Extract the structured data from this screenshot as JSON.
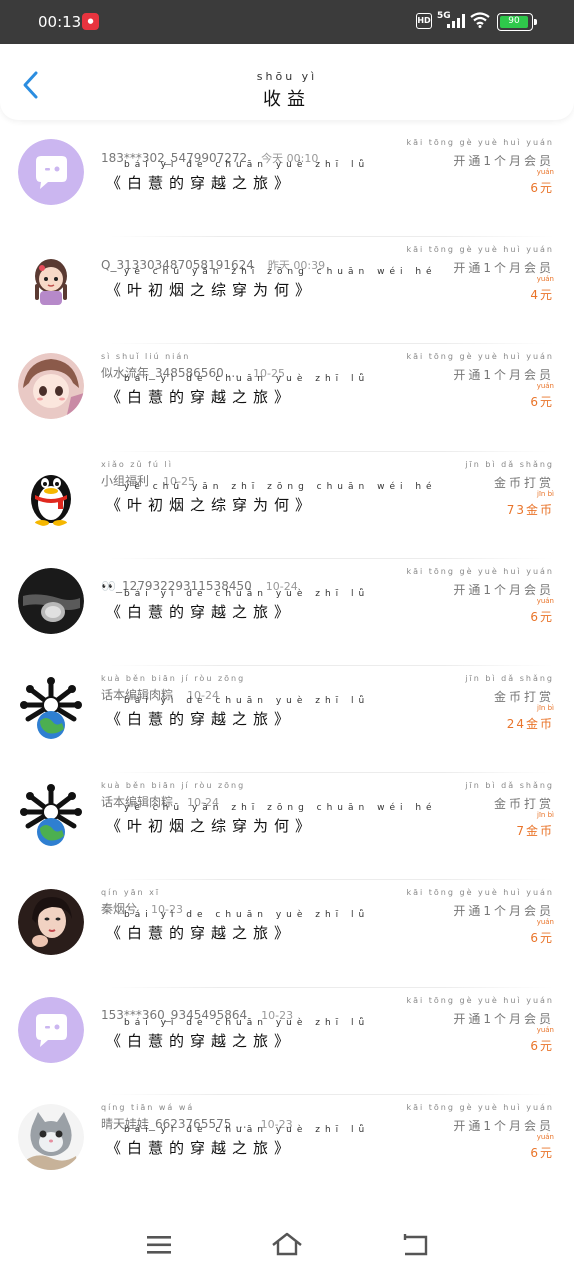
{
  "status_bar": {
    "time": "00:13",
    "app_badge": "doubao",
    "hd": "HD",
    "network": "5G",
    "battery": "90",
    "battery_color": "#2fc84b"
  },
  "header": {
    "back_icon": "chevron-left-icon",
    "title_pinyin": "shōu yì",
    "title": "收益",
    "accent_color": "#2b8de0"
  },
  "items": [
    {
      "avatar": "chat-bubble-avatar",
      "name_pinyin": "",
      "name": "183***302_5479907272",
      "time_pinyin": "jīn tiān",
      "time": "今天 00:10",
      "book_pinyin": "bái yì de chuān yuè zhī lǚ",
      "book": "《白薏的穿越之旅》",
      "type_pinyin": "kāi tōng gè yuè huì yuán",
      "type": "开通1个月会员",
      "amount_pinyin": "yuán",
      "amount": "6元"
    },
    {
      "avatar": "girl-doll-avatar",
      "name_pinyin": "",
      "name": "Q_3133034870581916​24",
      "time_pinyin": "zuó tiān",
      "time": "昨天 00:39",
      "book_pinyin": "yè chū yān zhī zōng chuān wéi hé",
      "book": "《叶初烟之综穿为何》",
      "type_pinyin": "kāi tōng gè yuè huì yuán",
      "type": "开通1个月会员",
      "amount_pinyin": "yuán",
      "amount": "4元"
    },
    {
      "avatar": "anime-girl-avatar",
      "name_pinyin": "sì shuǐ liú nián",
      "name": "似水流年_348586560 ...",
      "time_pinyin": "",
      "time": "10-25",
      "book_pinyin": "bái yì de chuān yuè zhī lǚ",
      "book": "《白薏的穿越之旅》",
      "type_pinyin": "kāi tōng gè yuè huì yuán",
      "type": "开通1个月会员",
      "amount_pinyin": "yuán",
      "amount": "6元"
    },
    {
      "avatar": "penguin-avatar",
      "name_pinyin": "xiǎo zǔ fú lì",
      "name": "小组福利",
      "time_pinyin": "",
      "time": "10-25",
      "book_pinyin": "yè chū yān zhī zōng chuān wéi hé",
      "book": "《叶初烟之综穿为何》",
      "type_pinyin": "jīn bì dǎ shǎng",
      "type": "金币打赏",
      "amount_pinyin": "jīn bì",
      "amount": "73金币"
    },
    {
      "avatar": "dark-photo-avatar",
      "name_pinyin": "",
      "name": "👀_1279322931​1538450",
      "time_pinyin": "",
      "time": "10-24",
      "book_pinyin": "bái yì de chuān yuè zhī lǚ",
      "book": "《白薏的穿越之旅》",
      "type_pinyin": "kāi tōng gè yuè huì yuán",
      "type": "开通1个月会员",
      "amount_pinyin": "yuán",
      "amount": "6元"
    },
    {
      "avatar": "bone-globe-avatar",
      "name_pinyin": "kuà běn biān jí ròu zōng",
      "name": "话本编辑肉粽",
      "time_pinyin": "",
      "time": "10-24",
      "book_pinyin": "bái yì de chuān yuè zhī lǚ",
      "book": "《白薏的穿越之旅》",
      "type_pinyin": "jīn bì dǎ shǎng",
      "type": "金币打赏",
      "amount_pinyin": "jīn bì",
      "amount": "24金币"
    },
    {
      "avatar": "bone-globe-avatar",
      "name_pinyin": "kuà běn biān jí ròu zōng",
      "name": "话本编辑肉粽",
      "time_pinyin": "",
      "time": "10-24",
      "book_pinyin": "yè chū yān zhī zōng chuān wéi hé",
      "book": "《叶初烟之综穿为何》",
      "type_pinyin": "jīn bì dǎ shǎng",
      "type": "金币打赏",
      "amount_pinyin": "jīn bì",
      "amount": "7金币"
    },
    {
      "avatar": "woman-photo-avatar",
      "name_pinyin": "qín yān xī",
      "name": "秦烟兮",
      "time_pinyin": "",
      "time": "10-23",
      "book_pinyin": "bái yì de chuān yuè zhī lǚ",
      "book": "《白薏的穿越之旅》",
      "type_pinyin": "kāi tōng gè yuè huì yuán",
      "type": "开通1个月会员",
      "amount_pinyin": "yuán",
      "amount": "6元"
    },
    {
      "avatar": "chat-bubble-avatar",
      "name_pinyin": "",
      "name": "153***360_9345495864",
      "time_pinyin": "",
      "time": "10-23",
      "book_pinyin": "bái yì de chuān yuè zhī lǚ",
      "book": "《白薏的穿越之旅》",
      "type_pinyin": "kāi tōng gè yuè huì yuán",
      "type": "开通1个月会员",
      "amount_pinyin": "yuán",
      "amount": "6元"
    },
    {
      "avatar": "cat-avatar",
      "name_pinyin": "qíng tiān wá wá",
      "name": "晴天娃娃_6623765575 ...",
      "time_pinyin": "",
      "time": "10-23",
      "book_pinyin": "bái yì de chuān yuè zhī lǚ",
      "book": "《白薏的穿越之旅》",
      "type_pinyin": "kāi tōng gè yuè huì yuán",
      "type": "开通1个月会员",
      "amount_pinyin": "yuán",
      "amount": "6元"
    }
  ],
  "navbar": {
    "menu_icon": "menu-icon",
    "home_icon": "home-icon",
    "back_icon": "back-icon"
  },
  "colors": {
    "amount": "#e9742a",
    "chat_avatar_bg": "#c8b4ee"
  }
}
